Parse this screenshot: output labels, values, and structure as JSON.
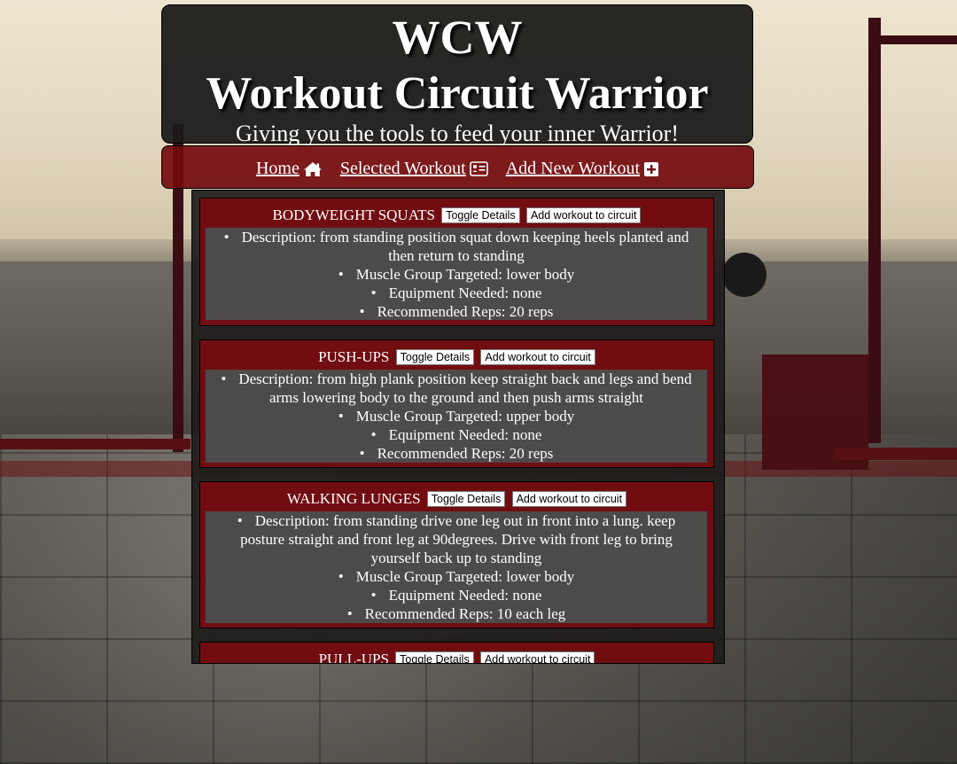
{
  "header": {
    "abbreviation": "WCW",
    "title": "Workout Circuit Warrior",
    "tagline": "Giving you the tools to feed your inner Warrior!"
  },
  "nav": {
    "home": {
      "label": "Home",
      "icon": "home-icon"
    },
    "selected": {
      "label": "Selected Workout",
      "icon": "id-card-icon"
    },
    "add": {
      "label": "Add New Workout",
      "icon": "plus-square-icon"
    }
  },
  "buttons": {
    "toggle": "Toggle Details",
    "add": "Add workout to circuit"
  },
  "workouts": [
    {
      "name": "BODYWEIGHT SQUATS",
      "description": "Description: from standing position squat down keeping heels planted and then return to standing",
      "muscle": "Muscle Group Targeted: lower body",
      "equipment": "Equipment Needed: none",
      "reps": "Recommended Reps: 20 reps"
    },
    {
      "name": "PUSH-UPS",
      "description": "Description: from high plank position keep straight back and legs and bend arms lowering body to the ground and then push arms straight",
      "muscle": "Muscle Group Targeted: upper body",
      "equipment": "Equipment Needed: none",
      "reps": "Recommended Reps: 20 reps"
    },
    {
      "name": "WALKING LUNGES",
      "description": "Description: from standing drive one leg out in front into a lung. keep posture straight and front leg at 90degrees. Drive with front leg to bring yourself back up to standing",
      "muscle": "Muscle Group Targeted: lower body",
      "equipment": "Equipment Needed: none",
      "reps": "Recommended Reps: 10 each leg"
    },
    {
      "name": "PULL-UPS"
    }
  ],
  "colors": {
    "header_bg": "#1c1b19",
    "nav_bg": "#730a0e",
    "card_bg": "#710d11",
    "details_bg": "#4d4a4a"
  }
}
